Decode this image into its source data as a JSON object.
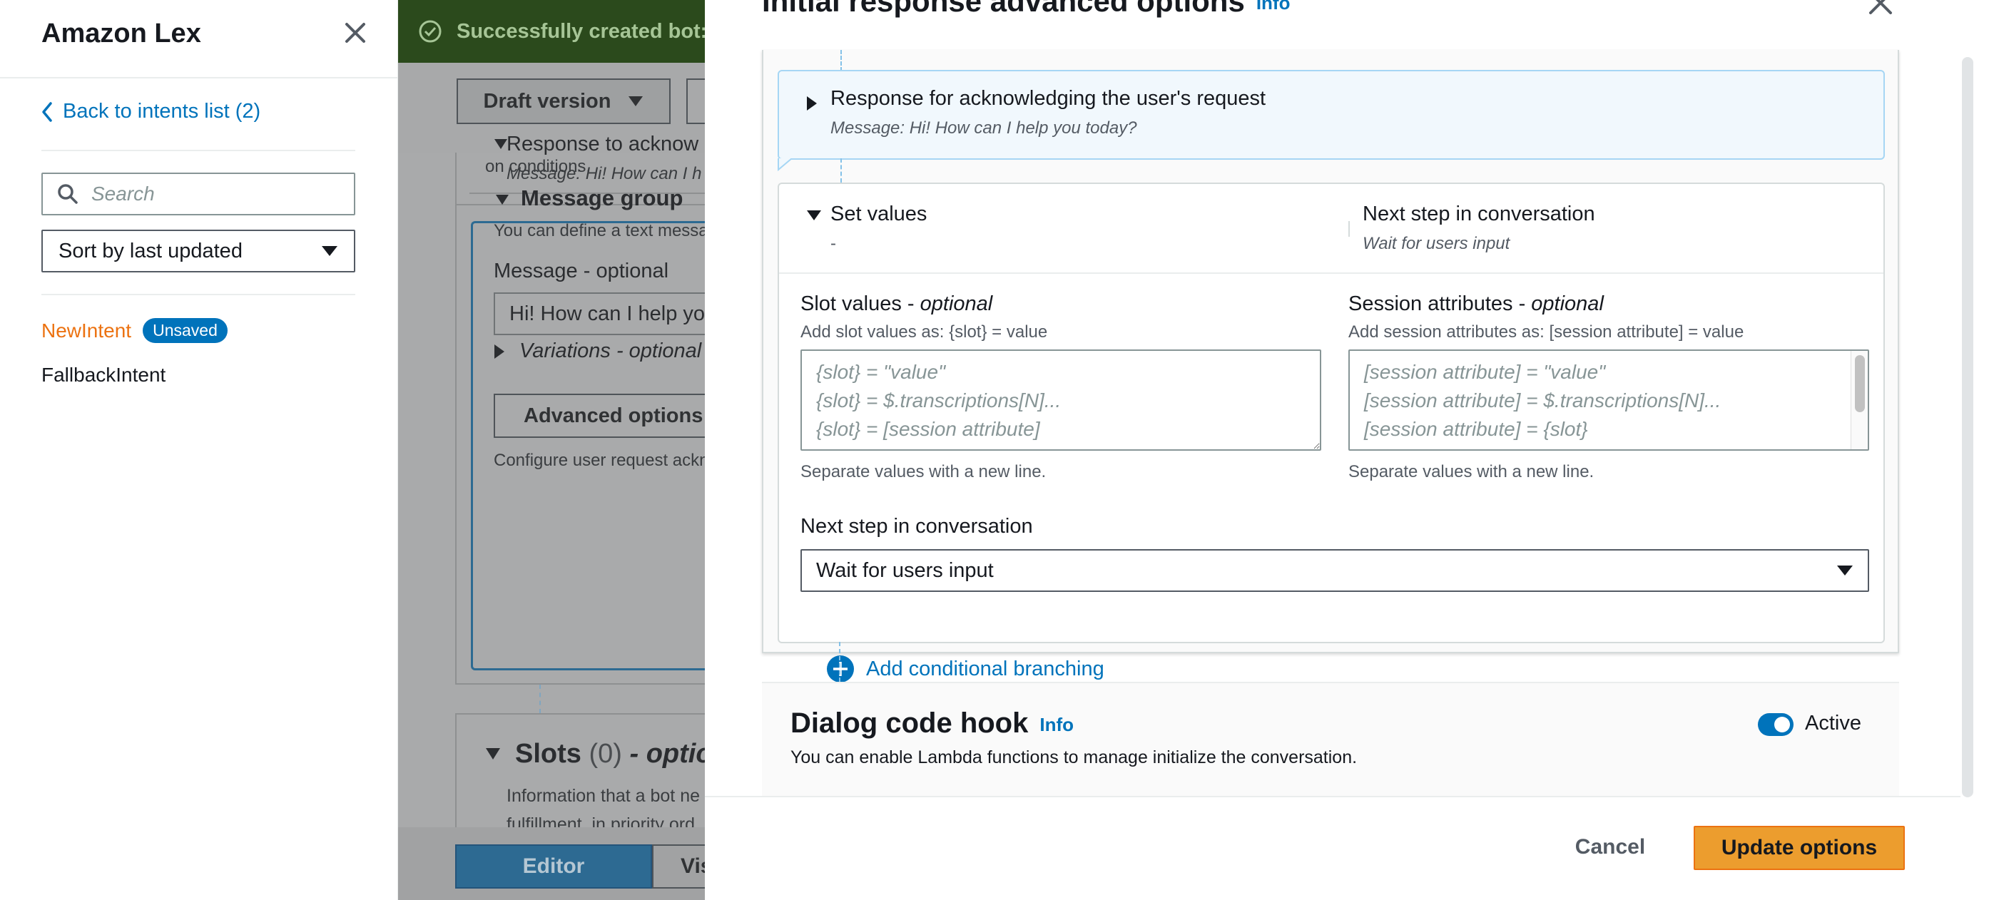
{
  "sidebar": {
    "title": "Amazon Lex",
    "back_link": "Back to intents list (2)",
    "search_placeholder": "Search",
    "sort_label": "Sort by last updated",
    "intents": [
      {
        "name": "NewIntent",
        "badge": "Unsaved"
      },
      {
        "name": "FallbackIntent"
      }
    ]
  },
  "background": {
    "banner": "Successfully created bot: C",
    "version_select": "Draft version",
    "conditions_text": "on conditions.",
    "response_title": "Response to acknow",
    "response_message": "Message: Hi! How can I h",
    "message_group_title": "Message group",
    "define_text": "You can define a text messa",
    "message_label": "Message - optional",
    "message_value": "Hi! How can I help you",
    "variations_label": "Variations - optional",
    "advanced_options_button": "Advanced options",
    "configure_text": "Configure user request ackn",
    "slots_title": "Slots",
    "slots_count": "(0)",
    "slots_optional": "- optional",
    "slots_desc_line1": "Information that a bot ne",
    "slots_desc_line2": "fulfillment, in priority ord",
    "tab_editor": "Editor",
    "tab_visual": "Vis"
  },
  "modal": {
    "title": "Initial response advanced options",
    "info_link": "Info",
    "response_card": {
      "title": "Response for acknowledging the user's request",
      "message": "Message: Hi! How can I help you today?"
    },
    "set_values": {
      "title": "Set values",
      "summary": "-",
      "next_step_title": "Next step in conversation",
      "next_step_value": "Wait for users input",
      "slot_label": "Slot values - ",
      "slot_label_optional": "optional",
      "slot_desc": "Add slot values as: {slot} = value",
      "slot_placeholder": "{slot} = \"value\"\n{slot} = $.transcriptions[N]...\n{slot} = [session attribute]",
      "slot_help": "Separate values with a new line.",
      "session_label": "Session attributes - ",
      "session_label_optional": "optional",
      "session_desc": "Add session attributes as: [session attribute] = value",
      "session_placeholder": "[session attribute] = \"value\"\n[session attribute] = $.transcriptions[N]...\n[session attribute] = {slot}",
      "session_help": "Separate values with a new line.",
      "next_step_label": "Next step in conversation",
      "next_step_select": "Wait for users input"
    },
    "add_branching": "Add conditional branching",
    "dialog_hook": {
      "title": "Dialog code hook",
      "info_link": "Info",
      "description": "You can enable Lambda functions to manage initialize the conversation.",
      "toggle_label": "Active",
      "toggle_on": true
    },
    "cancel_button": "Cancel",
    "update_button": "Update options"
  },
  "colors": {
    "link": "#0073bb",
    "accent_orange": "#ec7211",
    "primary_button": "#ec9d2e",
    "success_banner": "#2b4a1c"
  }
}
